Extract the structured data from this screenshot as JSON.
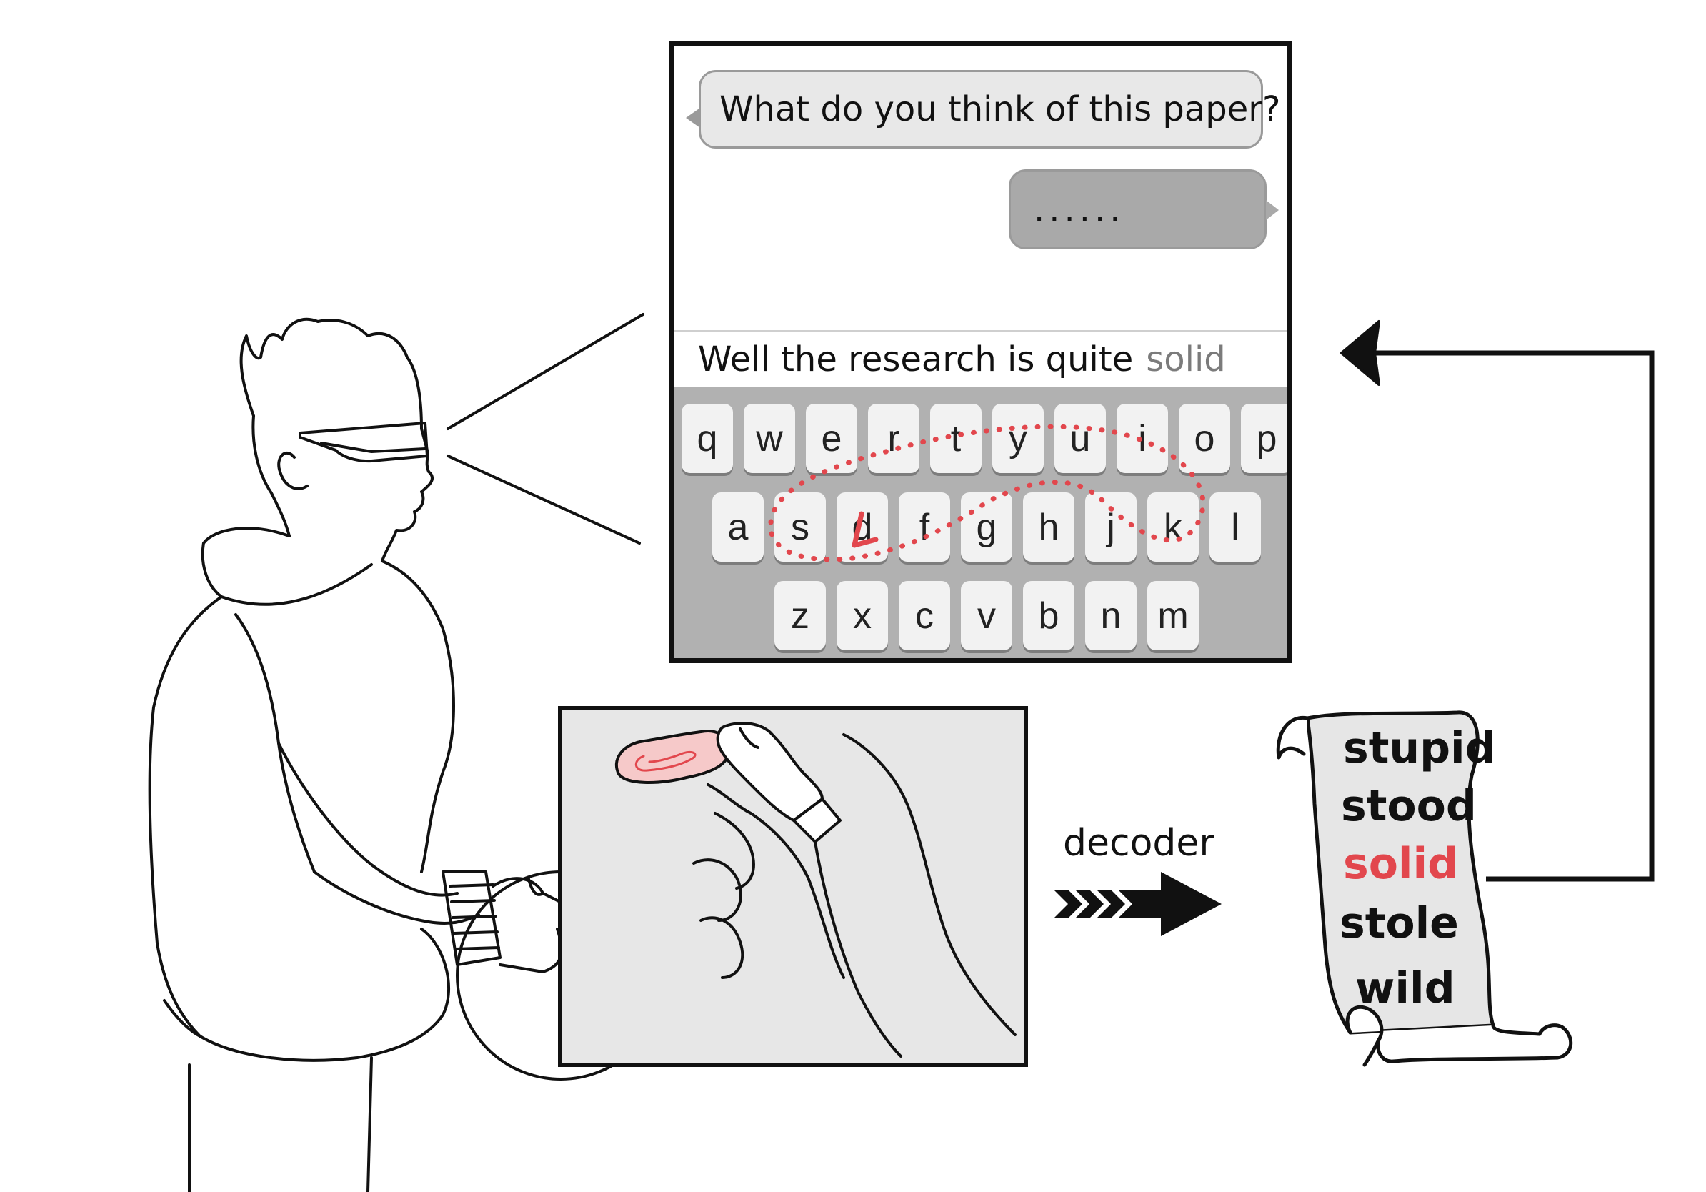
{
  "chat": {
    "incoming_message": "What do you think of this paper?",
    "outgoing_message": "......"
  },
  "input": {
    "typed_text": "Well the research is quite",
    "suggested_word": "solid"
  },
  "keyboard": {
    "rows": [
      [
        "q",
        "w",
        "e",
        "r",
        "t",
        "y",
        "u",
        "i",
        "o",
        "p"
      ],
      [
        "a",
        "s",
        "d",
        "f",
        "g",
        "h",
        "j",
        "k",
        "l"
      ],
      [
        "z",
        "x",
        "c",
        "v",
        "b",
        "n",
        "m"
      ]
    ]
  },
  "decoder": {
    "label": "decoder"
  },
  "candidates": {
    "words": [
      "stupid",
      "stood",
      "solid",
      "stole",
      "wild"
    ],
    "selected_word": "solid"
  },
  "colors": {
    "highlight": "#e2474d",
    "suggestion_gray": "#7b7b7b",
    "keyboard_bg": "#b1b1b1",
    "key_bg": "#f2f2f2",
    "inset_bg": "#e7e7e7",
    "scroll_bg": "#e6e6e6"
  },
  "icons": {
    "person": "person-with-smart-glasses-icon",
    "hand": "hand-thumb-swipe-icon",
    "decoder_arrow": "chevron-arrow-icon",
    "feedback_arrow": "return-arrow-icon",
    "scroll": "paper-scroll-icon"
  }
}
